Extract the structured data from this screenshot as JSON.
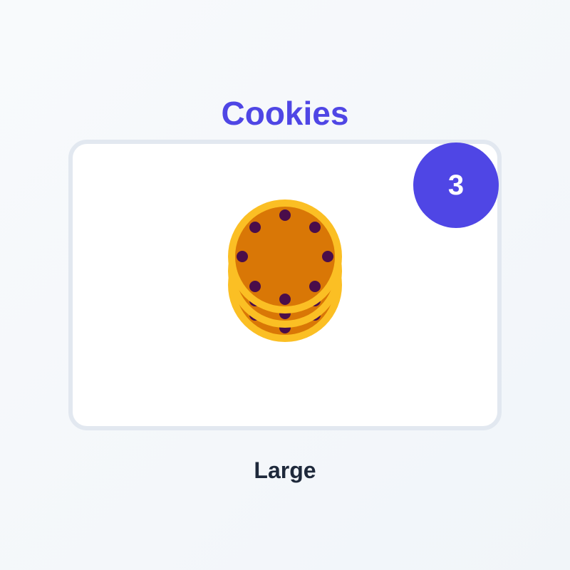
{
  "title": "Cookies",
  "count": "3",
  "size_label": "Large",
  "colors": {
    "accent": "#4f46e5",
    "title": "#4f46e5",
    "cookie_rim": "#fbbf24",
    "cookie_body": "#d97706",
    "chocolate_chip": "#4a0d4a",
    "label": "#1e293b"
  },
  "icon": "cookie-icon"
}
